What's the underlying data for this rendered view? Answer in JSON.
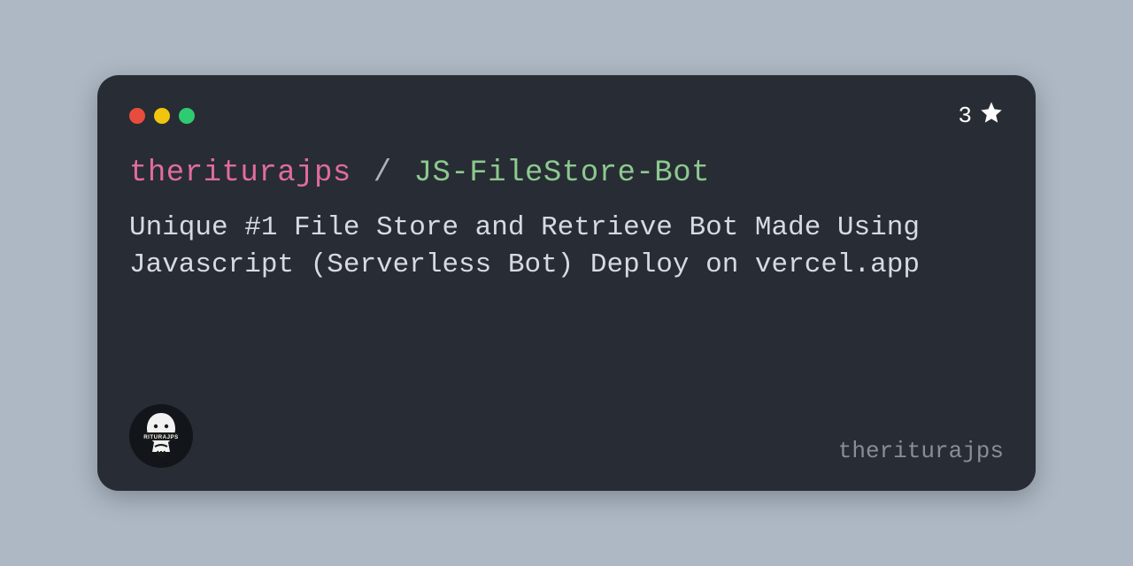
{
  "titlebar": {
    "star_count": "3"
  },
  "repo": {
    "owner": "theriturajps",
    "separator": "/",
    "name": "JS-FileStore-Bot",
    "description": "Unique #1 File Store and Retrieve Bot Made Using Javascript (Serverless Bot) Deploy on vercel.app"
  },
  "footer": {
    "handle": "theriturajps"
  }
}
